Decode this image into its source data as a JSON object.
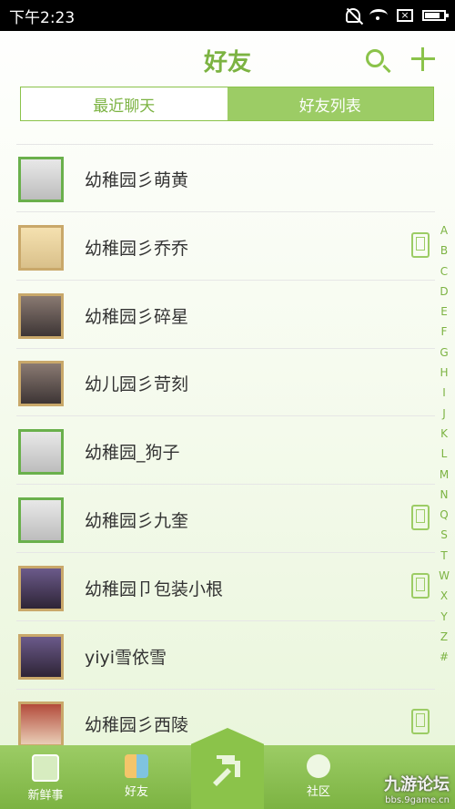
{
  "status": {
    "time": "下午2:23"
  },
  "header": {
    "title": "好友"
  },
  "tabs": [
    {
      "label": "最近聊天",
      "active": false
    },
    {
      "label": "好友列表",
      "active": true
    }
  ],
  "friends": [
    {
      "name": "幼稚园彡萌黄",
      "device": false,
      "avatar": "green"
    },
    {
      "name": "幼稚园彡乔乔",
      "device": true,
      "avatar": "frame-gold"
    },
    {
      "name": "幼稚园彡碎星",
      "device": false,
      "avatar": "frame-welcome"
    },
    {
      "name": "幼儿园彡苛刻",
      "device": false,
      "avatar": "frame-welcome"
    },
    {
      "name": "幼稚园_狗子",
      "device": false,
      "avatar": "green"
    },
    {
      "name": "幼稚园彡九奎",
      "device": true,
      "avatar": "green"
    },
    {
      "name": "幼稚园卩包装小根",
      "device": true,
      "avatar": "frame-crown"
    },
    {
      "name": "yiyi雪依雪",
      "device": false,
      "avatar": "frame-crown"
    },
    {
      "name": "幼稚园彡西陵",
      "device": true,
      "avatar": "frame-red"
    }
  ],
  "index_letters": [
    "A",
    "B",
    "C",
    "D",
    "E",
    "F",
    "G",
    "H",
    "I",
    "J",
    "K",
    "L",
    "M",
    "N",
    "Q",
    "S",
    "T",
    "W",
    "X",
    "Y",
    "Z",
    "#"
  ],
  "nav": {
    "items": [
      {
        "label": "新鲜事",
        "icon": "news-icon"
      },
      {
        "label": "好友",
        "icon": "friends-icon"
      },
      {
        "label": "社区",
        "icon": "community-icon"
      }
    ]
  },
  "watermark": {
    "title": "九游论坛",
    "url": "bbs.9game.cn"
  },
  "colors": {
    "accent": "#8bc34a",
    "accent_dark": "#7cb342",
    "status_bar": "#000000"
  }
}
